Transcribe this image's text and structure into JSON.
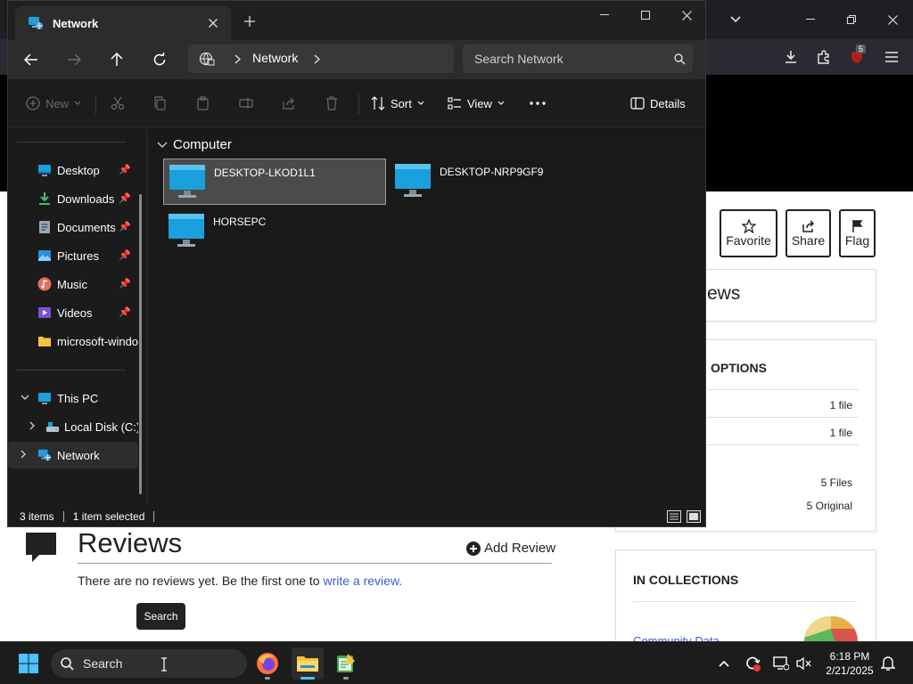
{
  "explorer": {
    "tab_title": "Network",
    "address": {
      "location": "Network"
    },
    "search": {
      "placeholder": "Search Network"
    },
    "commands": {
      "new": "New",
      "sort": "Sort",
      "view": "View",
      "details": "Details"
    },
    "sidebar": {
      "quick_access": [
        {
          "label": "Desktop",
          "icon": "desktop-icon"
        },
        {
          "label": "Downloads",
          "icon": "download-icon"
        },
        {
          "label": "Documents",
          "icon": "document-icon"
        },
        {
          "label": "Pictures",
          "icon": "pictures-icon"
        },
        {
          "label": "Music",
          "icon": "music-icon"
        },
        {
          "label": "Videos",
          "icon": "videos-icon"
        },
        {
          "label": "microsoft-windows",
          "icon": "folder-icon"
        }
      ],
      "this_pc": "This PC",
      "local_disk": "Local Disk (C:)",
      "network": "Network"
    },
    "content": {
      "group": "Computer",
      "items": [
        {
          "name": "DESKTOP-LKOD1L1",
          "selected": true
        },
        {
          "name": "DESKTOP-NRP9GF9",
          "selected": false
        },
        {
          "name": "HORSEPC",
          "selected": false
        }
      ]
    },
    "status": {
      "count": "3 items",
      "selection": "1 item selected"
    }
  },
  "browser": {
    "badge": "5",
    "actions": {
      "favorite": "Favorite",
      "share": "Share",
      "flag": "Flag"
    },
    "reviews_partial": "ews",
    "options_title": "OPTIONS",
    "options": [
      "1 file",
      "1 file",
      "5 Files",
      "5 Original"
    ],
    "reviews": {
      "title": "Reviews",
      "add_review": "Add Review",
      "empty_text": "There are no reviews yet. Be the first one to ",
      "empty_link": "write a review."
    },
    "search_button": "Search",
    "collections_title": "IN COLLECTIONS",
    "collections_link": "Community Data"
  },
  "taskbar": {
    "search": "Search",
    "time": "6:18 PM",
    "date": "2/21/2025"
  },
  "colors": {
    "accent": "#4cc2ff",
    "explorer_bg": "#191919",
    "monitor_blue": "#1aa0dc",
    "link": "#3b5bdb"
  }
}
